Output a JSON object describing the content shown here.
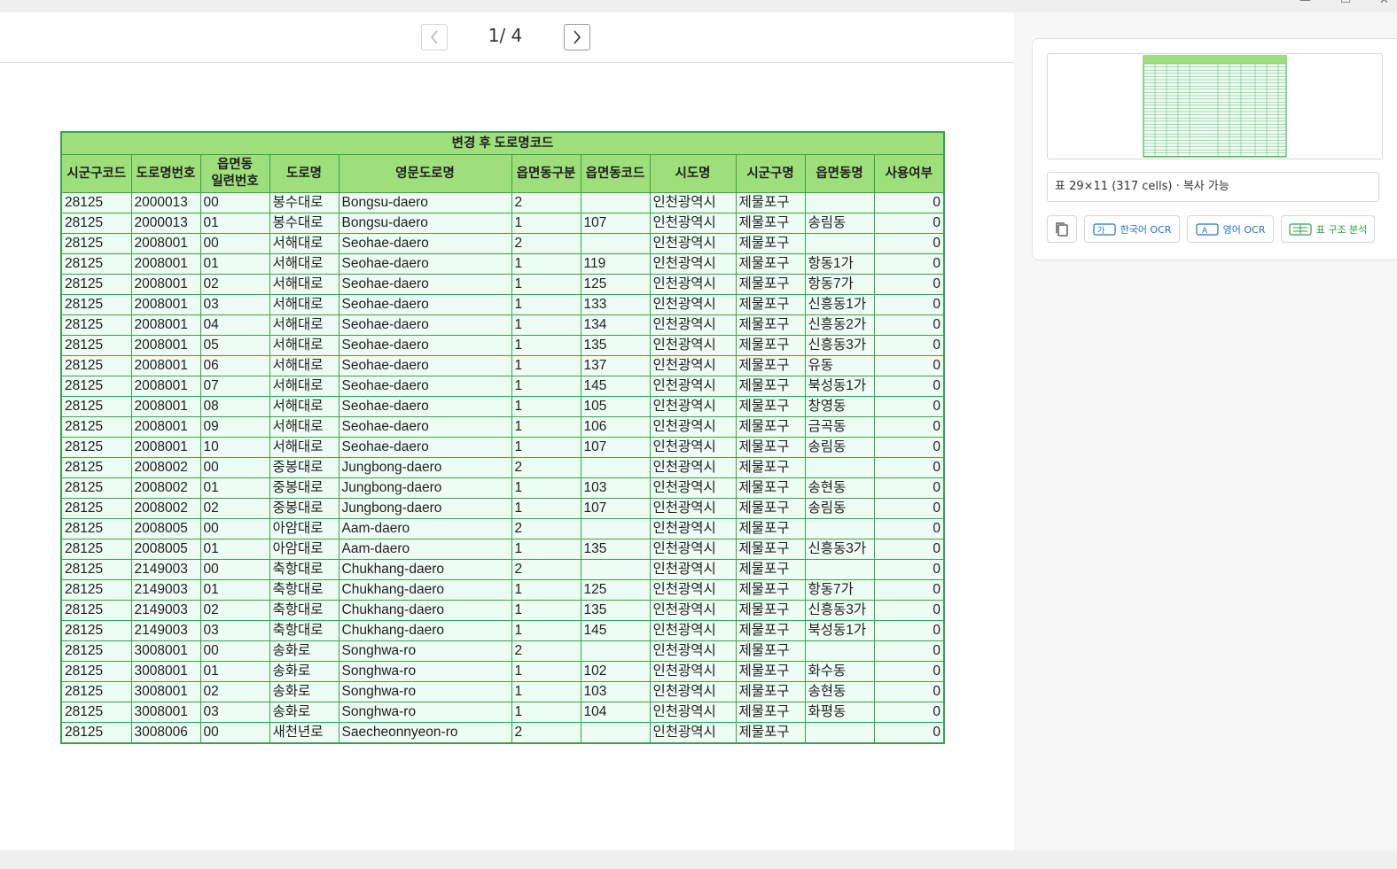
{
  "viewer": {
    "page_current": "1",
    "page_separator": "/",
    "page_total": "4"
  },
  "table": {
    "caption": "변경 후 도로명코드",
    "headers": [
      "시군구코드",
      "도로명번호",
      "읍면동\n일련번호",
      "도로명",
      "영문도로명",
      "읍면동구분",
      "읍면동코드",
      "시도명",
      "시군구명",
      "읍면동명",
      "사용여부"
    ],
    "rows": [
      [
        "28125",
        "2000013",
        "00",
        "봉수대로",
        "Bongsu-daero",
        "2",
        "",
        "인천광역시",
        "제물포구",
        "",
        "0"
      ],
      [
        "28125",
        "2000013",
        "01",
        "봉수대로",
        "Bongsu-daero",
        "1",
        "107",
        "인천광역시",
        "제물포구",
        "송림동",
        "0"
      ],
      [
        "28125",
        "2008001",
        "00",
        "서해대로",
        "Seohae-daero",
        "2",
        "",
        "인천광역시",
        "제물포구",
        "",
        "0"
      ],
      [
        "28125",
        "2008001",
        "01",
        "서해대로",
        "Seohae-daero",
        "1",
        "119",
        "인천광역시",
        "제물포구",
        "항동1가",
        "0"
      ],
      [
        "28125",
        "2008001",
        "02",
        "서해대로",
        "Seohae-daero",
        "1",
        "125",
        "인천광역시",
        "제물포구",
        "항동7가",
        "0"
      ],
      [
        "28125",
        "2008001",
        "03",
        "서해대로",
        "Seohae-daero",
        "1",
        "133",
        "인천광역시",
        "제물포구",
        "신흥동1가",
        "0"
      ],
      [
        "28125",
        "2008001",
        "04",
        "서해대로",
        "Seohae-daero",
        "1",
        "134",
        "인천광역시",
        "제물포구",
        "신흥동2가",
        "0"
      ],
      [
        "28125",
        "2008001",
        "05",
        "서해대로",
        "Seohae-daero",
        "1",
        "135",
        "인천광역시",
        "제물포구",
        "신흥동3가",
        "0"
      ],
      [
        "28125",
        "2008001",
        "06",
        "서해대로",
        "Seohae-daero",
        "1",
        "137",
        "인천광역시",
        "제물포구",
        "유동",
        "0"
      ],
      [
        "28125",
        "2008001",
        "07",
        "서해대로",
        "Seohae-daero",
        "1",
        "145",
        "인천광역시",
        "제물포구",
        "북성동1가",
        "0"
      ],
      [
        "28125",
        "2008001",
        "08",
        "서해대로",
        "Seohae-daero",
        "1",
        "105",
        "인천광역시",
        "제물포구",
        "창영동",
        "0"
      ],
      [
        "28125",
        "2008001",
        "09",
        "서해대로",
        "Seohae-daero",
        "1",
        "106",
        "인천광역시",
        "제물포구",
        "금곡동",
        "0"
      ],
      [
        "28125",
        "2008001",
        "10",
        "서해대로",
        "Seohae-daero",
        "1",
        "107",
        "인천광역시",
        "제물포구",
        "송림동",
        "0"
      ],
      [
        "28125",
        "2008002",
        "00",
        "중봉대로",
        "Jungbong-daero",
        "2",
        "",
        "인천광역시",
        "제물포구",
        "",
        "0"
      ],
      [
        "28125",
        "2008002",
        "01",
        "중봉대로",
        "Jungbong-daero",
        "1",
        "103",
        "인천광역시",
        "제물포구",
        "송현동",
        "0"
      ],
      [
        "28125",
        "2008002",
        "02",
        "중봉대로",
        "Jungbong-daero",
        "1",
        "107",
        "인천광역시",
        "제물포구",
        "송림동",
        "0"
      ],
      [
        "28125",
        "2008005",
        "00",
        "아암대로",
        "Aam-daero",
        "2",
        "",
        "인천광역시",
        "제물포구",
        "",
        "0"
      ],
      [
        "28125",
        "2008005",
        "01",
        "아암대로",
        "Aam-daero",
        "1",
        "135",
        "인천광역시",
        "제물포구",
        "신흥동3가",
        "0"
      ],
      [
        "28125",
        "2149003",
        "00",
        "축항대로",
        "Chukhang-daero",
        "2",
        "",
        "인천광역시",
        "제물포구",
        "",
        "0"
      ],
      [
        "28125",
        "2149003",
        "01",
        "축항대로",
        "Chukhang-daero",
        "1",
        "125",
        "인천광역시",
        "제물포구",
        "항동7가",
        "0"
      ],
      [
        "28125",
        "2149003",
        "02",
        "축항대로",
        "Chukhang-daero",
        "1",
        "135",
        "인천광역시",
        "제물포구",
        "신흥동3가",
        "0"
      ],
      [
        "28125",
        "2149003",
        "03",
        "축항대로",
        "Chukhang-daero",
        "1",
        "145",
        "인천광역시",
        "제물포구",
        "북성동1가",
        "0"
      ],
      [
        "28125",
        "3008001",
        "00",
        "송화로",
        "Songhwa-ro",
        "2",
        "",
        "인천광역시",
        "제물포구",
        "",
        "0"
      ],
      [
        "28125",
        "3008001",
        "01",
        "송화로",
        "Songhwa-ro",
        "1",
        "102",
        "인천광역시",
        "제물포구",
        "화수동",
        "0"
      ],
      [
        "28125",
        "3008001",
        "02",
        "송화로",
        "Songhwa-ro",
        "1",
        "103",
        "인천광역시",
        "제물포구",
        "송현동",
        "0"
      ],
      [
        "28125",
        "3008001",
        "03",
        "송화로",
        "Songhwa-ro",
        "1",
        "104",
        "인천광역시",
        "제물포구",
        "화평동",
        "0"
      ],
      [
        "28125",
        "3008006",
        "00",
        "새천년로",
        "Saecheonnyeon-ro",
        "2",
        "",
        "인천광역시",
        "제물포구",
        "",
        "0"
      ]
    ]
  },
  "panel": {
    "table_info": "표 29×11 (317 cells) · 복사 가능",
    "buttons": {
      "copy_icon": "copy-icon",
      "ocr_ko": "한국어 OCR",
      "ocr_en": "영어 OCR",
      "table_analysis": "표 구조 분석"
    }
  },
  "colors": {
    "header_green": "#9edf7c",
    "border_green": "#3aa14a",
    "cell_bg": "#eefdf3",
    "ocr_blue": "#1e73c9",
    "analysis_green": "#2f9d4a"
  }
}
